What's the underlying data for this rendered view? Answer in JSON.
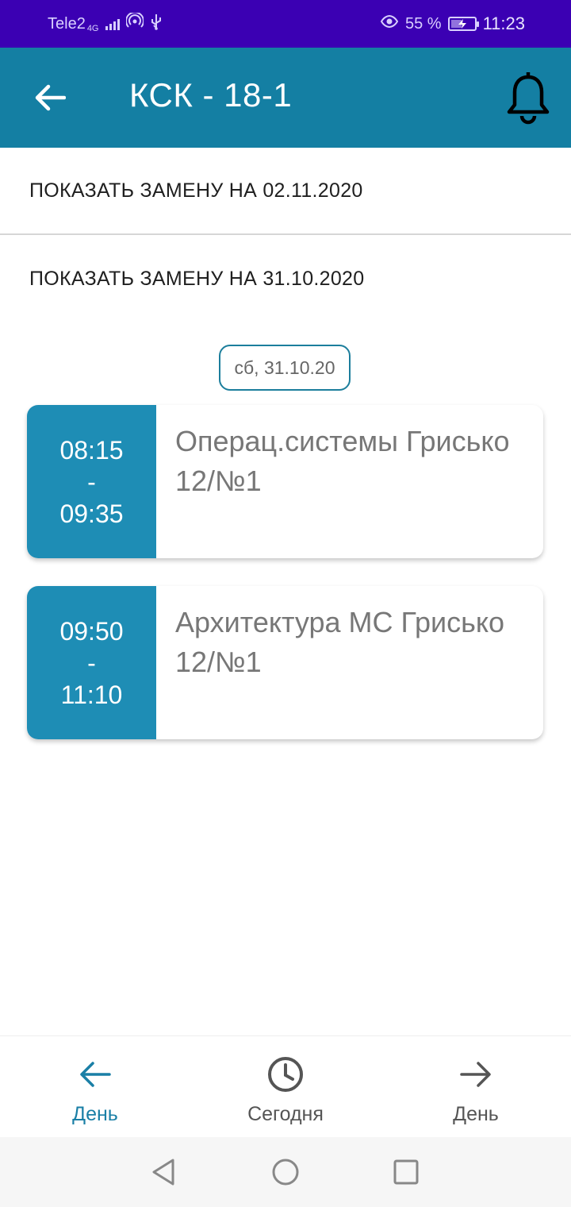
{
  "status_bar": {
    "carrier": "Tele2",
    "network": "4G",
    "battery_percent": "55 %",
    "battery_level": 0.55,
    "time": "11:23"
  },
  "app_bar": {
    "title": "КСК - 18-1",
    "back_icon": "arrow-left-icon",
    "bell_icon": "bell-icon",
    "background": "#147fa3"
  },
  "substitutions": [
    {
      "label": "ПОКАЗАТЬ ЗАМЕНУ НА 02.11.2020"
    },
    {
      "label": "ПОКАЗАТЬ ЗАМЕНУ НА 31.10.2020"
    }
  ],
  "day": {
    "date_label": "сб, 31.10.20",
    "lessons": [
      {
        "start": "08:15",
        "separator": "-",
        "end": "09:35",
        "subject": "Операц.системы Грисько",
        "room": "12/№1"
      },
      {
        "start": "09:50",
        "separator": "-",
        "end": "11:10",
        "subject": "Архитектура МС Грисько",
        "room": "12/№1"
      }
    ]
  },
  "bottom_nav": {
    "items": [
      {
        "label": "День",
        "icon": "arrow-left-icon",
        "active": true
      },
      {
        "label": "Сегодня",
        "icon": "clock-icon",
        "active": false
      },
      {
        "label": "День",
        "icon": "arrow-right-icon",
        "active": false
      }
    ]
  },
  "colors": {
    "status_bar": "#3b00b3",
    "accent": "#1a7fa6",
    "time_block": "#1e8db5"
  }
}
